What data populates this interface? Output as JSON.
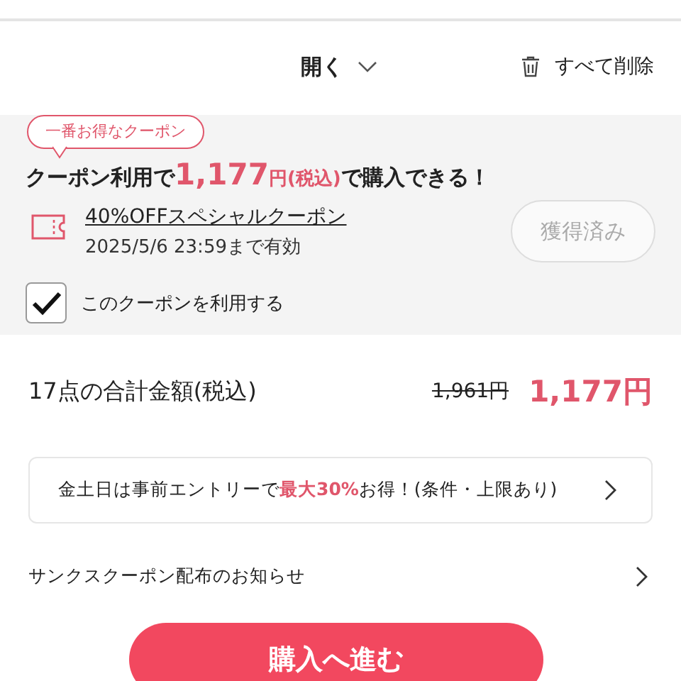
{
  "toolbar": {
    "expand_label": "開く",
    "delete_all_label": "すべて削除"
  },
  "coupon": {
    "badge": "一番お得なクーポン",
    "headline": [
      {
        "text": "クーポン利用で",
        "highlight": false,
        "kind": "plain"
      },
      {
        "text": "1,177",
        "highlight": true,
        "kind": "amount"
      },
      {
        "text": "円(税込)",
        "highlight": true,
        "kind": "unit"
      },
      {
        "text": "で購入できる！",
        "highlight": false,
        "kind": "plain"
      }
    ],
    "title": "40%OFFスペシャルクーポン",
    "expiry": "2025/5/6 23:59まで有効",
    "acquire_button": {
      "label": "獲得済み",
      "disabled": true
    },
    "use_checkbox": {
      "label": "このクーポンを利用する",
      "checked": true
    }
  },
  "total": {
    "label": "17点の合計金額(税込)",
    "original_price": "1,961円",
    "price": "1,177円"
  },
  "banner": {
    "parts": [
      {
        "text": "金土日は事前エントリーで",
        "highlight": false
      },
      {
        "text": "最大30%",
        "highlight": true
      },
      {
        "text": "お得！(条件・上限あり)",
        "highlight": false
      }
    ]
  },
  "notice": {
    "label": "サンクスクーポン配布のお知らせ"
  },
  "purchase_button": {
    "label": "購入へ進む"
  }
}
